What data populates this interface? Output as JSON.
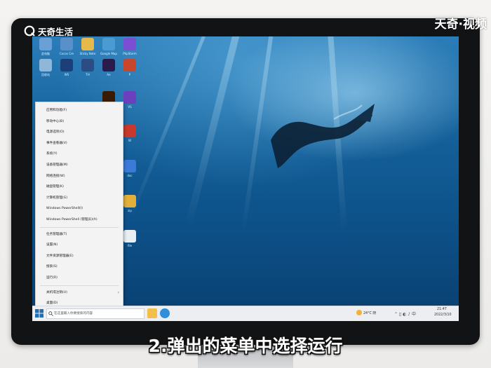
{
  "branding": {
    "left_logo_text": "天奇生活",
    "right_logo_text": "天奇·视频"
  },
  "subtitle": "2.弹出的菜单中选择运行",
  "desktop_icons": [
    {
      "label": "此电脑",
      "icon": "computer-icon",
      "color": "#6aa0d6"
    },
    {
      "label": "Cocos Cre",
      "icon": "cocos-icon",
      "color": "#5a8fc9"
    },
    {
      "label": "Sticky Note",
      "icon": "sticky-note-icon",
      "color": "#e5b94a"
    },
    {
      "label": "Google Map",
      "icon": "map-icon",
      "color": "#4b9bd3"
    },
    {
      "label": "PhpStorm",
      "icon": "phpstorm-icon",
      "color": "#7b4fd1"
    },
    {
      "label": "回收站",
      "icon": "recycle-bin-icon",
      "color": "#8fb7da"
    },
    {
      "label": "WS",
      "icon": "ws-icon",
      "color": "#1c3f7a"
    },
    {
      "label": "TH",
      "icon": "th-icon",
      "color": "#2b4d83"
    },
    {
      "label": "Ae",
      "icon": "after-effects-icon",
      "color": "#2a1b4d"
    },
    {
      "label": "P",
      "icon": "powerpoint-icon",
      "color": "#c8472c"
    },
    {
      "label": "Ai",
      "icon": "illustrator-icon",
      "color": "#3a1b00"
    },
    {
      "label": "VS",
      "icon": "visual-studio-icon",
      "color": "#6c3fbf"
    },
    {
      "label": "W",
      "icon": "wps-icon",
      "color": "#c8392b"
    },
    {
      "label": "doc",
      "icon": "document-icon",
      "color": "#3c7ad8"
    },
    {
      "label": "zip",
      "icon": "archive-icon",
      "color": "#e1b03a"
    },
    {
      "label": "file",
      "icon": "file-icon",
      "color": "#e9eef3"
    }
  ],
  "context_menu": {
    "items": [
      "应用和功能(F)",
      "移动中心(B)",
      "电源选项(O)",
      "事件查看器(V)",
      "系统(Y)",
      "设备管理器(M)",
      "网络连接(W)",
      "磁盘管理(K)",
      "计算机管理(G)",
      "Windows PowerShell(I)",
      "Windows PowerShell (管理员)(A)",
      "任务管理器(T)",
      "设置(N)",
      "文件资源管理器(E)",
      "搜索(S)",
      "运行(R)",
      "关机或注销(U)",
      "桌面(D)"
    ],
    "submenu_arrow": "›"
  },
  "taskbar": {
    "search_placeholder": "在这里输入你要搜索的内容",
    "weather": "24°C 阴",
    "clock_time": "21:47",
    "clock_date": "2022/3/10"
  },
  "colors": {
    "accent": "#1f6fb2",
    "menu_bg": "#f3f3f3",
    "taskbar_bg": "#eceef1"
  }
}
